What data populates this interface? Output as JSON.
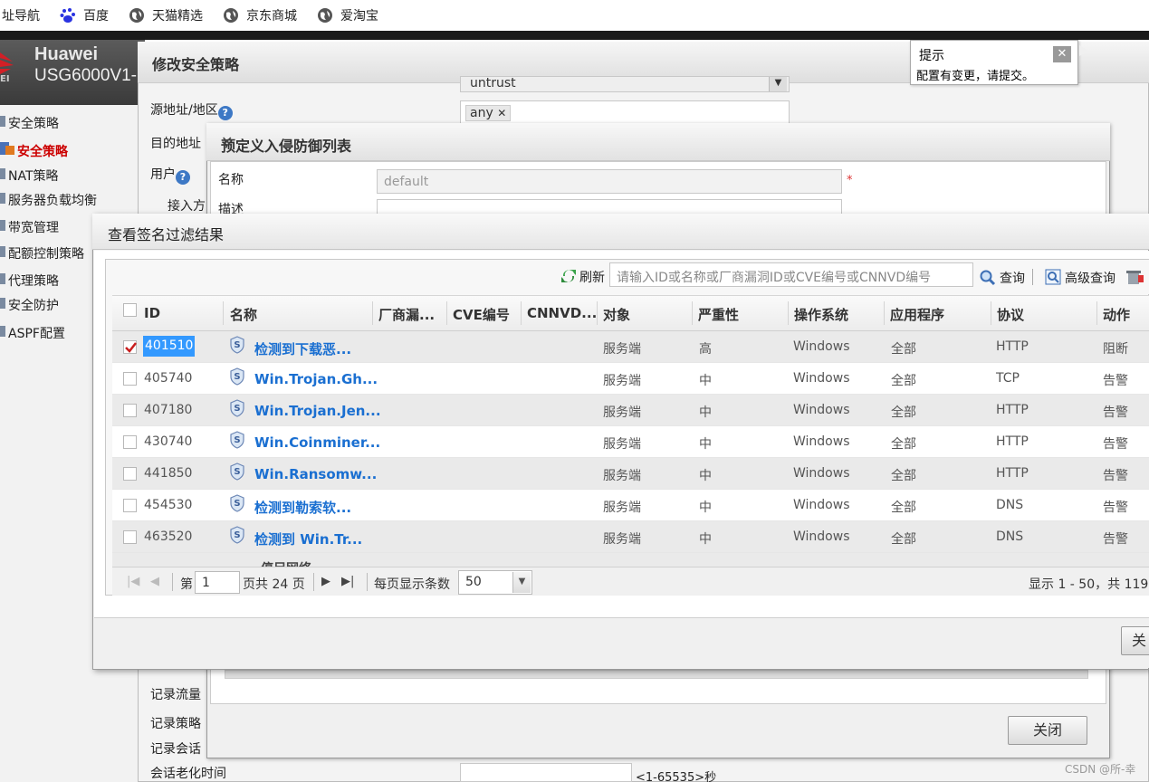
{
  "bookmarks": [
    {
      "label": "址导航",
      "icon": "nav-icon"
    },
    {
      "label": "百度",
      "icon": "baidu-paw-icon"
    },
    {
      "label": "天猫精选",
      "icon": "globe-icon"
    },
    {
      "label": "京东商城",
      "icon": "globe-icon"
    },
    {
      "label": "爱淘宝",
      "icon": "globe-icon"
    }
  ],
  "brand": {
    "name": "Huawei",
    "model": "USG6000V1-",
    "small": "EI"
  },
  "sidebar": {
    "items": [
      {
        "label": "安全策略"
      },
      {
        "label": "安全策略",
        "active": true
      },
      {
        "label": "NAT策略"
      },
      {
        "label": "服务器负载均衡"
      },
      {
        "label": "带宽管理"
      },
      {
        "label": "配额控制策略"
      },
      {
        "label": "代理策略"
      },
      {
        "label": "安全防护"
      },
      {
        "label": "ASPF配置"
      }
    ]
  },
  "tooltip": {
    "title": "提示",
    "message": "配置有变更，请提交。",
    "close": "✕"
  },
  "dialog1": {
    "title": "修改安全策略",
    "fields": {
      "zone_value": "untrust",
      "src_region": "源地址/地区",
      "src_tag": "any",
      "dst_region": "目的地址",
      "user": "用户",
      "access": "接入方",
      "log_traffic": "记录流量",
      "log_policy": "记录策略",
      "log_session": "记录会话",
      "session_age": "会话老化时间",
      "session_range": "<1-65535>秒"
    }
  },
  "dialog2": {
    "title": "预定义入侵防御列表",
    "name_label": "名称",
    "name_placeholder": "default",
    "desc_label": "描述",
    "close_button": "关闭",
    "close_x": "✕"
  },
  "dialog3": {
    "title": "查看签名过滤结果",
    "toolbar": {
      "refresh": "刷新",
      "search_placeholder": "请输入ID或名称或厂商漏洞ID或CVE编号或CNNVD编号",
      "query": "查询",
      "advanced": "高级查询"
    },
    "columns": [
      "ID",
      "名称",
      "厂商漏...",
      "CVE编号",
      "CNNVD...",
      "对象",
      "严重性",
      "操作系统",
      "应用程序",
      "协议",
      "动作"
    ],
    "rows": [
      {
        "id": "401510",
        "name": "检测到下载恶...",
        "target": "服务端",
        "severity": "高",
        "os": "Windows",
        "app": "全部",
        "protocol": "HTTP",
        "action": "阻断",
        "checked": true
      },
      {
        "id": "405740",
        "name": "Win.Trojan.Gh...",
        "target": "服务端",
        "severity": "中",
        "os": "Windows",
        "app": "全部",
        "protocol": "TCP",
        "action": "告警"
      },
      {
        "id": "407180",
        "name": "Win.Trojan.Jen...",
        "target": "服务端",
        "severity": "中",
        "os": "Windows",
        "app": "全部",
        "protocol": "HTTP",
        "action": "告警"
      },
      {
        "id": "430740",
        "name": "Win.Coinminer...",
        "target": "服务端",
        "severity": "中",
        "os": "Windows",
        "app": "全部",
        "protocol": "HTTP",
        "action": "告警"
      },
      {
        "id": "441850",
        "name": "Win.Ransomw...",
        "target": "服务端",
        "severity": "中",
        "os": "Windows",
        "app": "全部",
        "protocol": "HTTP",
        "action": "告警"
      },
      {
        "id": "454530",
        "name": "检测到勒索软...",
        "target": "服务端",
        "severity": "中",
        "os": "Windows",
        "app": "全部",
        "protocol": "DNS",
        "action": "告警"
      },
      {
        "id": "463520",
        "name": "检测到 Win.Tr...",
        "target": "服务端",
        "severity": "中",
        "os": "Windows",
        "app": "全部",
        "protocol": "DNS",
        "action": "告警"
      }
    ],
    "partial_row": "...停足网络",
    "pager": {
      "page_prefix": "第",
      "page_value": "1",
      "page_suffix": "页共 24 页",
      "per_page_label": "每页显示条数",
      "per_page_value": "50",
      "summary": "显示 1 - 50，共 119"
    },
    "footer_button": "关"
  },
  "watermark": "CSDN @所-幸",
  "colors": {
    "link": "#1a6fd1",
    "selection": "#3399ff",
    "active_nav": "#cc0000"
  }
}
